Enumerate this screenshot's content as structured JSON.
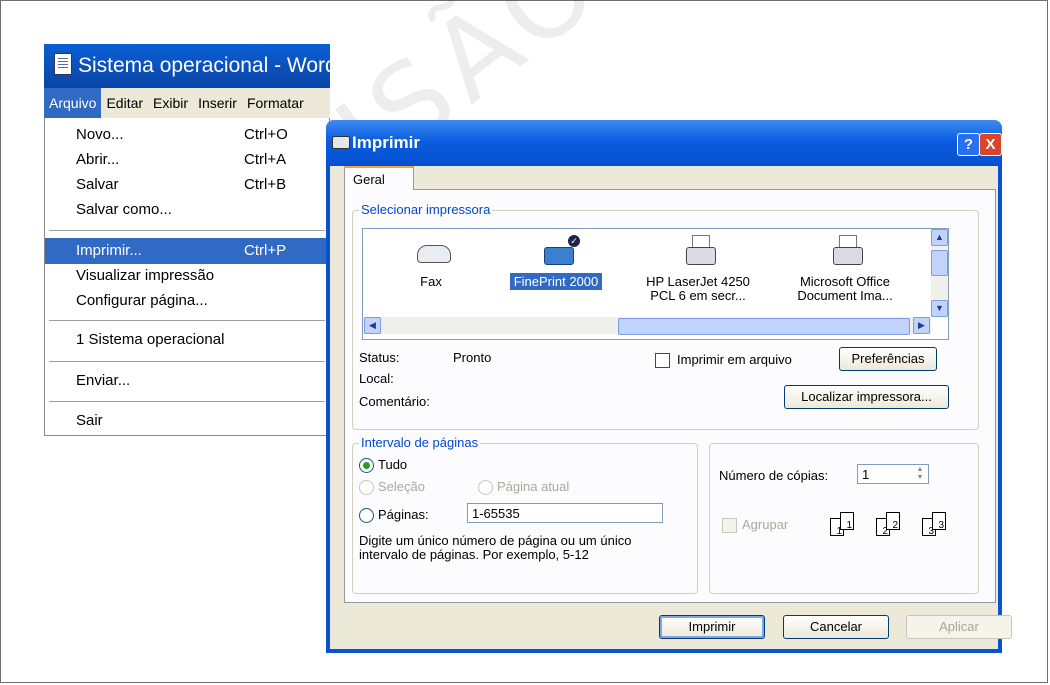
{
  "word_window": {
    "title": "Sistema operacional - Word",
    "menubar": [
      "Arquivo",
      "Editar",
      "Exibir",
      "Inserir",
      "Formatar"
    ],
    "active_menu": "Arquivo"
  },
  "arquivo_menu": {
    "items": [
      {
        "label": "Novo...",
        "shortcut": "Ctrl+O"
      },
      {
        "label": "Abrir...",
        "shortcut": "Ctrl+A"
      },
      {
        "label": "Salvar",
        "shortcut": "Ctrl+B"
      },
      {
        "label": "Salvar como...",
        "shortcut": ""
      },
      {
        "label": "Imprimir...",
        "shortcut": "Ctrl+P",
        "selected": true
      },
      {
        "label": "Visualizar impressão",
        "shortcut": ""
      },
      {
        "label": "Configurar página...",
        "shortcut": ""
      },
      {
        "label": "1 Sistema operacional",
        "shortcut": ""
      },
      {
        "label": "Enviar...",
        "shortcut": ""
      },
      {
        "label": "Sair",
        "shortcut": ""
      }
    ]
  },
  "print_dialog": {
    "title": "Imprimir",
    "help_button": "?",
    "close_button": "X",
    "tab": "Geral",
    "select_printer": {
      "label": "Selecionar impressora",
      "printers": [
        {
          "name": "Fax",
          "icon": "fax-icon"
        },
        {
          "name": "FinePrint 2000",
          "icon": "printer-default-icon",
          "selected": true
        },
        {
          "name_line1": "HP LaserJet 4250",
          "name_line2": "PCL 6 em secr...",
          "icon": "printer-icon"
        },
        {
          "name_line1": "Microsoft Office",
          "name_line2": "Document Ima...",
          "icon": "printer-icon"
        }
      ],
      "status_label": "Status:",
      "status_value": "Pronto",
      "local_label": "Local:",
      "comment_label": "Comentário:",
      "print_to_file": "Imprimir em arquivo",
      "preferences_button": "Preferências",
      "find_printer_button": "Localizar impressora..."
    },
    "page_range": {
      "label": "Intervalo de páginas",
      "all": "Tudo",
      "selection": "Seleção",
      "current_page": "Página atual",
      "pages": "Páginas:",
      "pages_value": "1-65535",
      "hint": "Digite um único número de página ou um único intervalo de páginas. Por exemplo, 5-12"
    },
    "copies": {
      "label": "Número de cópias:",
      "value": "1",
      "collate": "Agrupar",
      "collate_pages": [
        "1",
        "1",
        "2",
        "2",
        "3",
        "3"
      ]
    },
    "buttons": {
      "print": "Imprimir",
      "cancel": "Cancelar",
      "apply": "Aplicar"
    }
  },
  "watermark": "REVISÃO"
}
